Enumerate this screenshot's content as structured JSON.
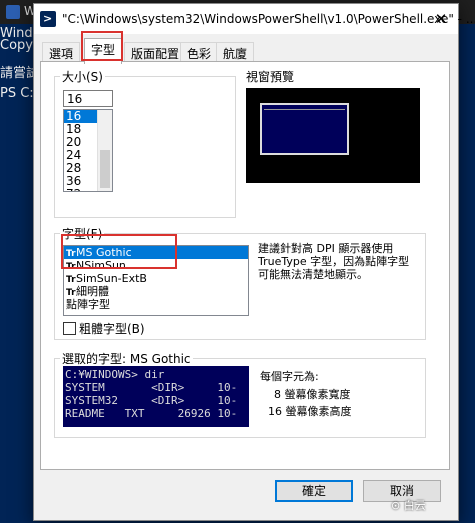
{
  "background": {
    "title": "W",
    "lines": [
      "Windo",
      "Copyr",
      "",
      "請嘗試",
      "",
      "PS C:"
    ]
  },
  "dialog": {
    "title": "\"C:\\Windows\\system32\\WindowsPowerShell\\v1.0\\PowerShell.exe\" - ...",
    "close": "✕",
    "tabs": [
      {
        "label": "選項",
        "active": false
      },
      {
        "label": "字型",
        "active": true
      },
      {
        "label": "版面配置",
        "active": false
      },
      {
        "label": "色彩",
        "active": false
      },
      {
        "label": "航廈",
        "active": false
      }
    ]
  },
  "size": {
    "label": "大小(S)",
    "value": "16",
    "items": [
      "16",
      "18",
      "20",
      "24",
      "28",
      "36",
      "72"
    ],
    "selected_index": 0
  },
  "preview": {
    "label": "視窗預覽"
  },
  "font": {
    "label": "字型(F)",
    "items": [
      {
        "name": "MS Gothic",
        "truetype": true,
        "selected": true
      },
      {
        "name": "NSimSun",
        "truetype": true,
        "selected": false
      },
      {
        "name": "SimSun-ExtB",
        "truetype": true,
        "selected": false
      },
      {
        "name": "細明體",
        "truetype": true,
        "selected": false
      },
      {
        "name": "點陣字型",
        "truetype": false,
        "selected": false
      }
    ],
    "tt_symbol": "Tr",
    "note": "建議針對高 DPI 顯示器使用 TrueType 字型，因為點陣字型可能無法清楚地顯示。",
    "bold_label": "粗體字型(B)",
    "bold_checked": false
  },
  "selected_font": {
    "label": "選取的字型: MS Gothic",
    "sample": "C:¥WINDOWS> dir\nSYSTEM       <DIR>     10-\nSYSTEM32     <DIR>     10-\nREADME   TXT     26926 10-",
    "char_label": "每個字元為:",
    "width_text": "8 螢幕像素寬度",
    "height_text": "16 螢幕像素高度"
  },
  "buttons": {
    "ok": "確定",
    "cancel": "取消"
  },
  "watermark": "⊙ 白云"
}
